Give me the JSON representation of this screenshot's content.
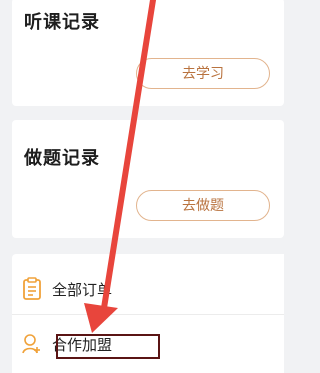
{
  "listen_record": {
    "title": "听课记录",
    "button": "去学习"
  },
  "exercise_record": {
    "title": "做题记录",
    "button": "去做题"
  },
  "menu": {
    "orders": {
      "label": "全部订单",
      "icon": "clipboard-icon"
    },
    "join": {
      "label": "合作加盟",
      "icon": "add-user-icon"
    }
  },
  "annotation": {
    "arrow_color": "#e8453c",
    "box_color": "#5a1414"
  },
  "colors": {
    "accent": "#b9733f",
    "pill_border": "#e2b48e",
    "icon": "#f0a23a"
  }
}
